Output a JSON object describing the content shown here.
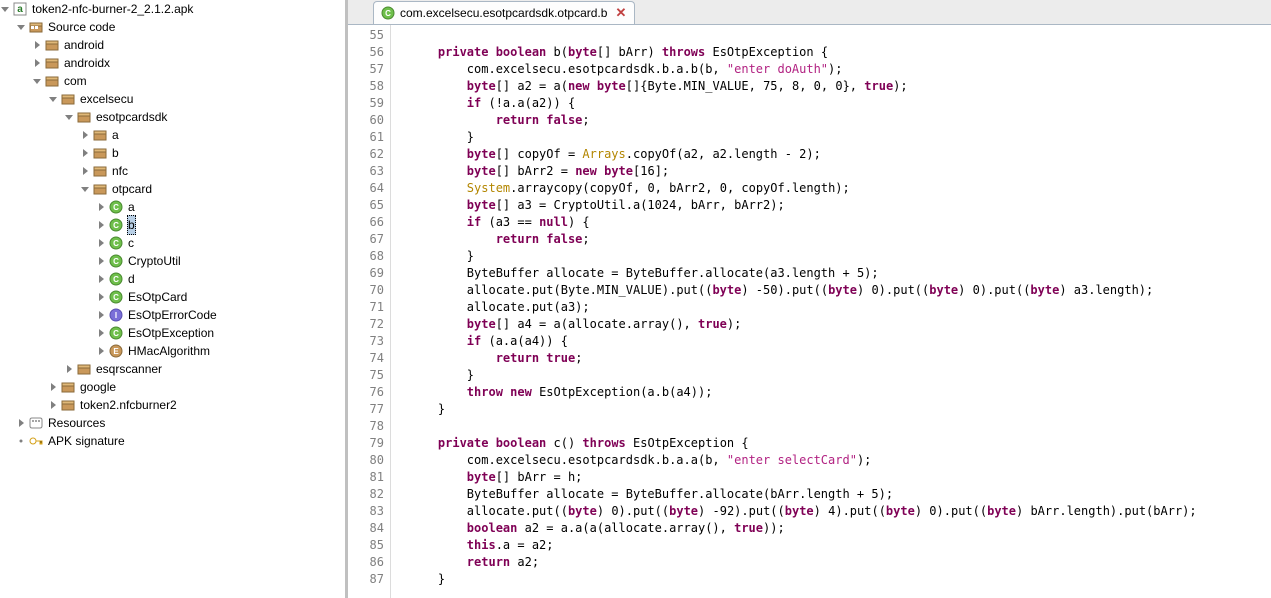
{
  "tree": {
    "root": "token2-nfc-burner-2_2.1.2.apk",
    "sourceCode": "Source code",
    "android": "android",
    "androidx": "androidx",
    "com": "com",
    "excelsecu": "excelsecu",
    "esotpcardsdk": "esotpcardsdk",
    "a1": "a",
    "b1": "b",
    "nfc": "nfc",
    "otpcard": "otpcard",
    "oa": "a",
    "ob": "b",
    "oc": "c",
    "cryptoutil": "CryptoUtil",
    "od": "d",
    "esotpcard": "EsOtpCard",
    "esotperrorcode": "EsOtpErrorCode",
    "esotpexception": "EsOtpException",
    "hmacalgorithm": "HMacAlgorithm",
    "esqrscanner": "esqrscanner",
    "google": "google",
    "token2nfcburner2": "token2.nfcburner2",
    "resources": "Resources",
    "apksignature": "APK signature"
  },
  "tab": {
    "title": "com.excelsecu.esotpcardsdk.otpcard.b",
    "close": "✕"
  },
  "code": {
    "startLine": 55,
    "lines": [
      [],
      [
        [
          "    ",
          ""
        ],
        [
          "private ",
          "kw"
        ],
        [
          "boolean ",
          "kw"
        ],
        [
          "b",
          ""
        ],
        [
          "(",
          ""
        ],
        [
          "byte",
          "kw"
        ],
        [
          "[] bArr",
          ""
        ],
        [
          ") ",
          ""
        ],
        [
          "throws ",
          "kw"
        ],
        [
          "EsOtpException {",
          ""
        ]
      ],
      [
        [
          "        com.excelsecu.esotpcardsdk.b.a.b(b, ",
          ""
        ],
        [
          "\"enter doAuth\"",
          "str"
        ],
        [
          ");",
          ""
        ]
      ],
      [
        [
          "        ",
          ""
        ],
        [
          "byte",
          "kw"
        ],
        [
          "[] a2 = a(",
          ""
        ],
        [
          "new ",
          "kw"
        ],
        [
          "byte",
          "kw"
        ],
        [
          "[]{",
          ""
        ],
        [
          "Byte",
          ""
        ],
        [
          ".MIN_VALUE, ",
          ""
        ],
        [
          "75",
          ""
        ],
        [
          ", ",
          ""
        ],
        [
          "8",
          ""
        ],
        [
          ", ",
          ""
        ],
        [
          "0",
          ""
        ],
        [
          ", ",
          ""
        ],
        [
          "0",
          ""
        ],
        [
          "}, ",
          ""
        ],
        [
          "true",
          "kw"
        ],
        [
          ");",
          ""
        ]
      ],
      [
        [
          "        ",
          ""
        ],
        [
          "if ",
          "kw"
        ],
        [
          "(!a.a(a2)) {",
          ""
        ]
      ],
      [
        [
          "            ",
          ""
        ],
        [
          "return ",
          "kw"
        ],
        [
          "false",
          "kw"
        ],
        [
          ";",
          ""
        ]
      ],
      [
        [
          "        }",
          ""
        ]
      ],
      [
        [
          "        ",
          ""
        ],
        [
          "byte",
          "kw"
        ],
        [
          "[] copyOf = ",
          ""
        ],
        [
          "Arrays",
          "call"
        ],
        [
          ".copyOf(a2, a2.length - ",
          ""
        ],
        [
          "2",
          ""
        ],
        [
          ");",
          ""
        ]
      ],
      [
        [
          "        ",
          ""
        ],
        [
          "byte",
          "kw"
        ],
        [
          "[] bArr2 = ",
          ""
        ],
        [
          "new ",
          "kw"
        ],
        [
          "byte",
          "kw"
        ],
        [
          "[",
          ""
        ],
        [
          "16",
          ""
        ],
        [
          "];",
          ""
        ]
      ],
      [
        [
          "        ",
          ""
        ],
        [
          "System",
          "call"
        ],
        [
          ".arraycopy(copyOf, ",
          ""
        ],
        [
          "0",
          ""
        ],
        [
          ", bArr2, ",
          ""
        ],
        [
          "0",
          ""
        ],
        [
          ", copyOf.length);",
          ""
        ]
      ],
      [
        [
          "        ",
          ""
        ],
        [
          "byte",
          "kw"
        ],
        [
          "[] a3 = CryptoUtil.a(",
          ""
        ],
        [
          "1024",
          ""
        ],
        [
          ", bArr, bArr2);",
          ""
        ]
      ],
      [
        [
          "        ",
          ""
        ],
        [
          "if ",
          "kw"
        ],
        [
          "(a3 == ",
          ""
        ],
        [
          "null",
          "kw"
        ],
        [
          ") {",
          ""
        ]
      ],
      [
        [
          "            ",
          ""
        ],
        [
          "return ",
          "kw"
        ],
        [
          "false",
          "kw"
        ],
        [
          ";",
          ""
        ]
      ],
      [
        [
          "        }",
          ""
        ]
      ],
      [
        [
          "        ByteBuffer allocate = ByteBuffer.allocate(a3.length + ",
          ""
        ],
        [
          "5",
          ""
        ],
        [
          ");",
          ""
        ]
      ],
      [
        [
          "        allocate.put(",
          ""
        ],
        [
          "Byte",
          ""
        ],
        [
          ".MIN_VALUE).put((",
          ""
        ],
        [
          "byte",
          "kw"
        ],
        [
          ") -",
          ""
        ],
        [
          "50",
          ""
        ],
        [
          ").put((",
          ""
        ],
        [
          "byte",
          "kw"
        ],
        [
          ") ",
          ""
        ],
        [
          "0",
          ""
        ],
        [
          ").put((",
          ""
        ],
        [
          "byte",
          "kw"
        ],
        [
          ") ",
          ""
        ],
        [
          "0",
          ""
        ],
        [
          ").put((",
          ""
        ],
        [
          "byte",
          "kw"
        ],
        [
          ") a3.length);",
          ""
        ]
      ],
      [
        [
          "        allocate.put(a3);",
          ""
        ]
      ],
      [
        [
          "        ",
          ""
        ],
        [
          "byte",
          "kw"
        ],
        [
          "[] a4 = a(allocate.array(), ",
          ""
        ],
        [
          "true",
          "kw"
        ],
        [
          ");",
          ""
        ]
      ],
      [
        [
          "        ",
          ""
        ],
        [
          "if ",
          "kw"
        ],
        [
          "(a.a(a4)) {",
          ""
        ]
      ],
      [
        [
          "            ",
          ""
        ],
        [
          "return ",
          "kw"
        ],
        [
          "true",
          "kw"
        ],
        [
          ";",
          ""
        ]
      ],
      [
        [
          "        }",
          ""
        ]
      ],
      [
        [
          "        ",
          ""
        ],
        [
          "throw ",
          "kw"
        ],
        [
          "new ",
          "kw"
        ],
        [
          "EsOtpException(a.b(a4));",
          ""
        ]
      ],
      [
        [
          "    }",
          ""
        ]
      ],
      [],
      [
        [
          "    ",
          ""
        ],
        [
          "private ",
          "kw"
        ],
        [
          "boolean ",
          "kw"
        ],
        [
          "c",
          ""
        ],
        [
          "() ",
          ""
        ],
        [
          "throws ",
          "kw"
        ],
        [
          "EsOtpException {",
          ""
        ]
      ],
      [
        [
          "        com.excelsecu.esotpcardsdk.b.a.a(b, ",
          ""
        ],
        [
          "\"enter selectCard\"",
          "str"
        ],
        [
          ");",
          ""
        ]
      ],
      [
        [
          "        ",
          ""
        ],
        [
          "byte",
          "kw"
        ],
        [
          "[] bArr = h;",
          ""
        ]
      ],
      [
        [
          "        ByteBuffer allocate = ByteBuffer.allocate(bArr.length + ",
          ""
        ],
        [
          "5",
          ""
        ],
        [
          ");",
          ""
        ]
      ],
      [
        [
          "        allocate.put((",
          ""
        ],
        [
          "byte",
          "kw"
        ],
        [
          ") ",
          ""
        ],
        [
          "0",
          ""
        ],
        [
          ").put((",
          ""
        ],
        [
          "byte",
          "kw"
        ],
        [
          ") -",
          ""
        ],
        [
          "92",
          ""
        ],
        [
          ").put((",
          ""
        ],
        [
          "byte",
          "kw"
        ],
        [
          ") ",
          ""
        ],
        [
          "4",
          ""
        ],
        [
          ").put((",
          ""
        ],
        [
          "byte",
          "kw"
        ],
        [
          ") ",
          ""
        ],
        [
          "0",
          ""
        ],
        [
          ").put((",
          ""
        ],
        [
          "byte",
          "kw"
        ],
        [
          ") bArr.length).put(bArr);",
          ""
        ]
      ],
      [
        [
          "        ",
          ""
        ],
        [
          "boolean ",
          "kw"
        ],
        [
          "a2 = a.a(a(allocate.array(), ",
          ""
        ],
        [
          "true",
          "kw"
        ],
        [
          "));",
          ""
        ]
      ],
      [
        [
          "        ",
          ""
        ],
        [
          "this",
          "kw"
        ],
        [
          ".a = a2;",
          ""
        ]
      ],
      [
        [
          "        ",
          ""
        ],
        [
          "return ",
          "kw"
        ],
        [
          "a2;",
          ""
        ]
      ],
      [
        [
          "    }",
          ""
        ]
      ]
    ]
  },
  "chart_data": null
}
